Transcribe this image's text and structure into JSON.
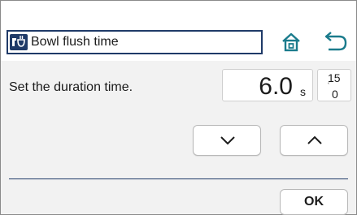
{
  "header": {
    "title": "Bowl flush time",
    "icon": "bowl-flush-icon",
    "home_icon": "home-icon",
    "back_icon": "return-icon",
    "accent_color": "#1f3a68",
    "icon_color": "#1a7b8c"
  },
  "setting": {
    "prompt": "Set the duration time.",
    "value": "6.0",
    "unit": "s",
    "range_max": "15",
    "range_sep": "ʿ",
    "range_min": "0"
  },
  "controls": {
    "decrease_icon": "chevron-down-icon",
    "increase_icon": "chevron-up-icon",
    "ok_label": "OK"
  }
}
